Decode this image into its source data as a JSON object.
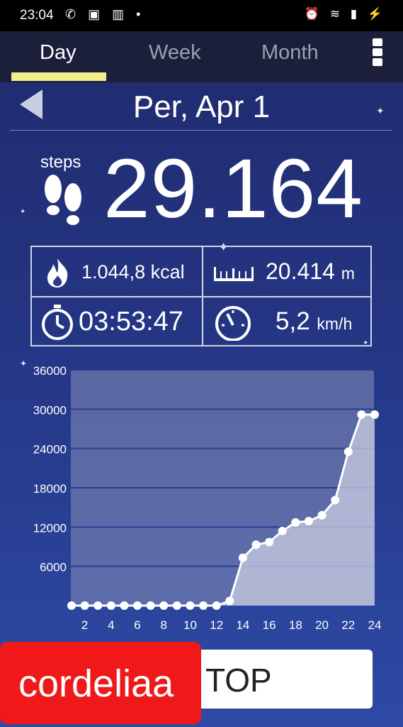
{
  "status_bar": {
    "time": "23:04",
    "left_icons": "✆ ▣ ▥ •",
    "right_icons": "⏰ ≋ ▮ ⚡"
  },
  "tabs": [
    {
      "label": "Day",
      "active": true
    },
    {
      "label": "Week",
      "active": false
    },
    {
      "label": "Month",
      "active": false
    }
  ],
  "date": {
    "label": "Per, Apr 1"
  },
  "steps": {
    "label": "steps",
    "value": "29.164"
  },
  "stats": {
    "calories": {
      "value": "1.044,8 kcal"
    },
    "distance": {
      "value": "20.414",
      "unit": "m"
    },
    "duration": {
      "value": "03:53:47"
    },
    "speed": {
      "value": "5,2",
      "unit": "km/h"
    }
  },
  "chart_data": {
    "type": "line",
    "x": [
      1,
      2,
      3,
      4,
      5,
      6,
      7,
      8,
      9,
      10,
      11,
      12,
      13,
      14,
      15,
      16,
      17,
      18,
      19,
      20,
      21,
      22,
      23,
      24
    ],
    "values": [
      0,
      0,
      0,
      0,
      0,
      0,
      0,
      0,
      0,
      0,
      0,
      0,
      700,
      7300,
      9300,
      9700,
      11400,
      12700,
      12900,
      13800,
      16100,
      23500,
      29164,
      29164
    ],
    "x_ticks": [
      "2",
      "4",
      "6",
      "8",
      "10",
      "12",
      "14",
      "16",
      "18",
      "20",
      "22",
      "24"
    ],
    "y_ticks": [
      "6000",
      "12000",
      "18000",
      "24000",
      "30000",
      "36000"
    ],
    "ylim": [
      0,
      36000
    ],
    "xlim": [
      1,
      24
    ],
    "grid": true,
    "line_color": "#ffffff",
    "fill_color": "#c9cfe2"
  },
  "stop_button": {
    "label": "TOP"
  },
  "watermark": {
    "text": "cordeliaa"
  },
  "colors": {
    "accent": "#f3ee8c",
    "background": "#243583"
  }
}
